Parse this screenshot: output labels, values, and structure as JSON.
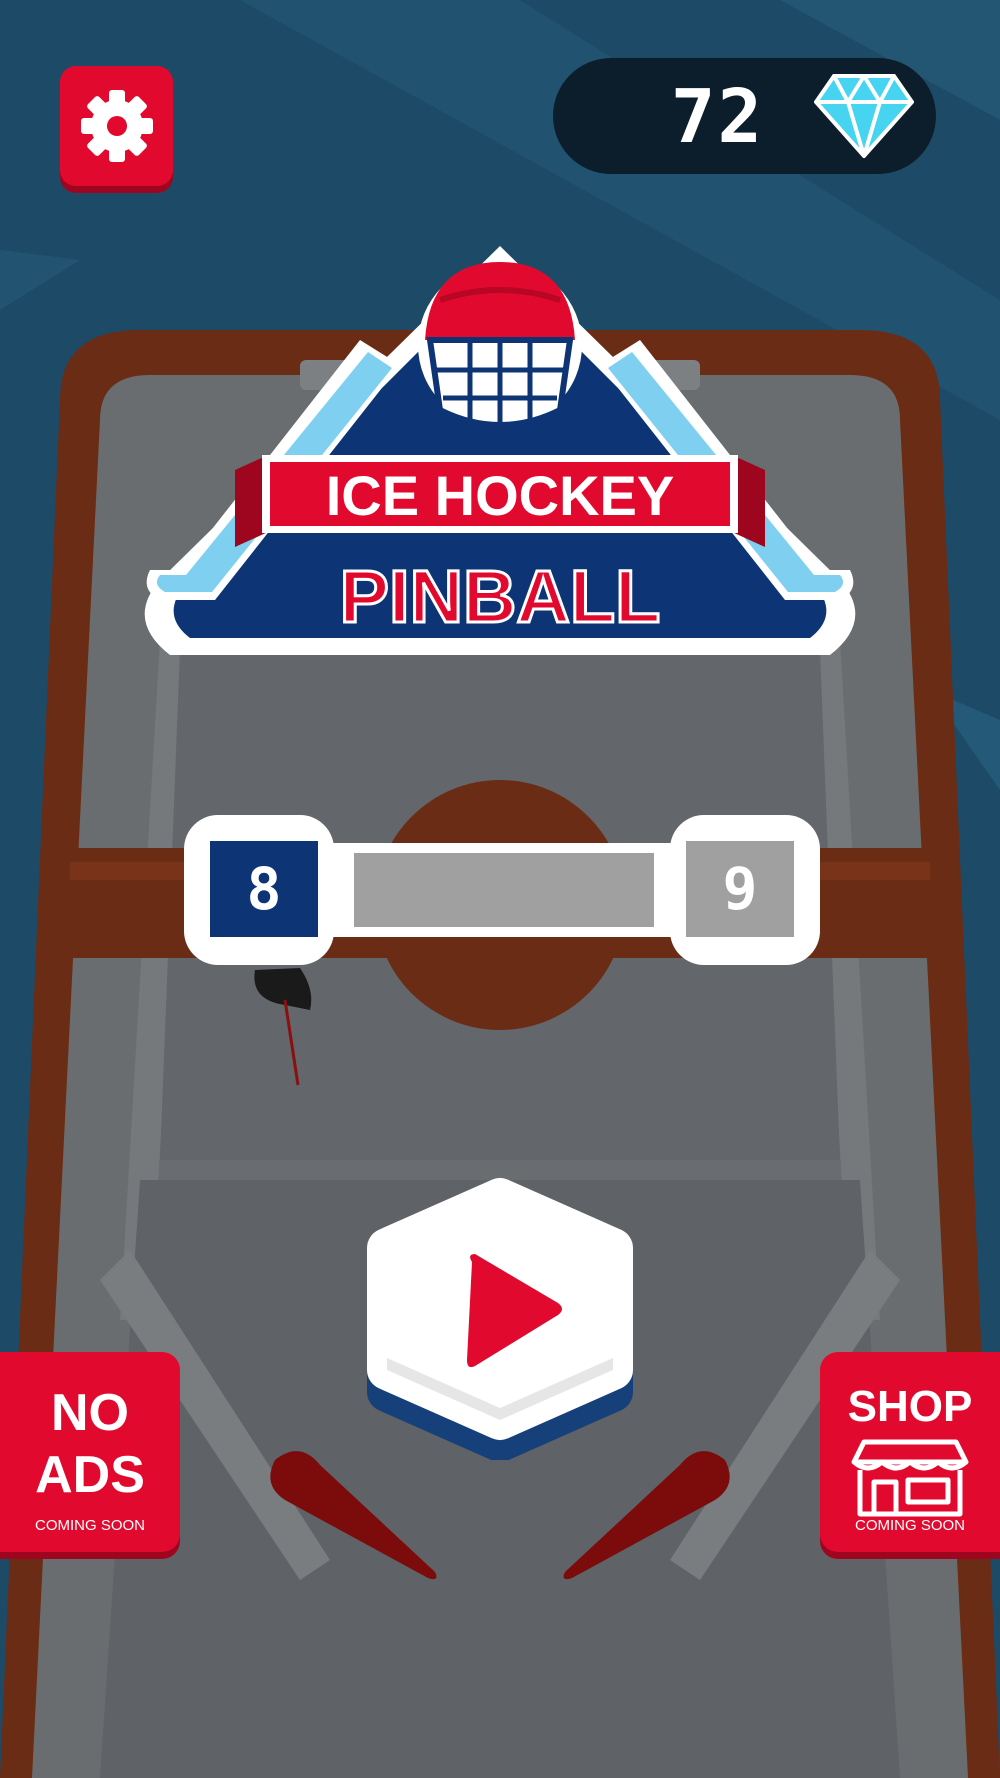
{
  "logo": {
    "line1": "ICE HOCKEY",
    "line2": "PINBALL"
  },
  "gems": {
    "count": "72",
    "icon": "diamond-icon"
  },
  "settings": {
    "icon": "gear-icon"
  },
  "score": {
    "left": "8",
    "right": "9"
  },
  "play": {
    "icon": "play-icon"
  },
  "no_ads": {
    "line1": "NO",
    "line2": "ADS",
    "subtitle": "COMING SOON"
  },
  "shop": {
    "label": "SHOP",
    "subtitle": "COMING SOON",
    "icon": "store-icon"
  },
  "colors": {
    "accent_red": "#e2092e",
    "navy": "#0d3474",
    "background": "#1d4a66",
    "table_gray": "#6a6d70",
    "rink_brown": "#6a2c14"
  }
}
